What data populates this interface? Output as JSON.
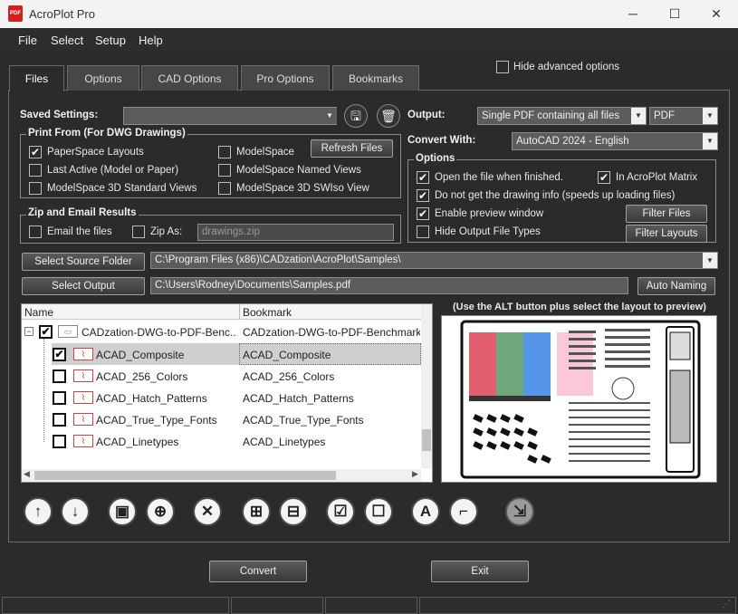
{
  "window": {
    "title": "AcroPlot Pro",
    "app_icon_label": "PDF"
  },
  "menu": [
    "File",
    "Select",
    "Setup",
    "Help"
  ],
  "tabs": [
    "Files",
    "Options",
    "CAD Options",
    "Pro Options",
    "Bookmarks"
  ],
  "hide_advanced": {
    "label": "Hide advanced options",
    "checked": false
  },
  "saved_settings": {
    "label": "Saved Settings:",
    "value": ""
  },
  "print_from": {
    "title": "Print From (For DWG Drawings)",
    "items": [
      {
        "label": "PaperSpace Layouts",
        "checked": true
      },
      {
        "label": "ModelSpace",
        "checked": false
      },
      {
        "label": "Last Active (Model or Paper)",
        "checked": false
      },
      {
        "label": "ModelSpace Named Views",
        "checked": false
      },
      {
        "label": "ModelSpace 3D Standard Views",
        "checked": false
      },
      {
        "label": "ModelSpace 3D SWIso View",
        "checked": false
      }
    ],
    "refresh_label": "Refresh Files"
  },
  "zip": {
    "title": "Zip and Email Results",
    "email": {
      "label": "Email the files",
      "checked": false
    },
    "zipas": {
      "label": "Zip As:",
      "checked": false
    },
    "filename": "drawings.zip"
  },
  "output": {
    "label": "Output:",
    "value": "Single PDF containing all files",
    "format": "PDF"
  },
  "convert_with": {
    "label": "Convert With:",
    "value": "AutoCAD 2024 - English"
  },
  "options": {
    "title": "Options",
    "items": [
      {
        "label": "Open the file when finished.",
        "checked": true
      },
      {
        "label": "In AcroPlot Matrix",
        "checked": true
      },
      {
        "label": "Do not get the drawing info (speeds up loading files)",
        "checked": true
      },
      {
        "label": "Enable preview window",
        "checked": true
      },
      {
        "label": "Hide Output File Types",
        "checked": false
      }
    ],
    "filter_files": "Filter Files",
    "filter_layouts": "Filter Layouts"
  },
  "source": {
    "button": "Select Source Folder",
    "path": "C:\\Program Files (x86)\\CADzation\\AcroPlot\\Samples\\"
  },
  "output_path": {
    "button": "Select Output",
    "path": "C:\\Users\\Rodney\\Documents\\Samples.pdf",
    "auto_naming": "Auto Naming"
  },
  "tree": {
    "headers": [
      "Name",
      "Bookmark"
    ],
    "root": {
      "name": "CADzation-DWG-to-PDF-Benc...",
      "bookmark": "CADzation-DWG-to-PDF-Benchmark",
      "expander": "−"
    },
    "children": [
      {
        "name": "ACAD_Composite",
        "bookmark": "ACAD_Composite",
        "checked": true,
        "selected": true
      },
      {
        "name": "ACAD_256_Colors",
        "bookmark": "ACAD_256_Colors",
        "checked": false,
        "selected": false
      },
      {
        "name": "ACAD_Hatch_Patterns",
        "bookmark": "ACAD_Hatch_Patterns",
        "checked": false,
        "selected": false
      },
      {
        "name": "ACAD_True_Type_Fonts",
        "bookmark": "ACAD_True_Type_Fonts",
        "checked": false,
        "selected": false
      },
      {
        "name": "ACAD_Linetypes",
        "bookmark": "ACAD_Linetypes",
        "checked": false,
        "selected": false
      }
    ]
  },
  "preview": {
    "caption": "(Use the ALT button plus select the layout to preview)"
  },
  "toolbar": [
    "move-up",
    "move-down",
    "add-folder",
    "add-file",
    "remove",
    "expand-all",
    "collapse-all",
    "check-all",
    "uncheck-all",
    "font-tool",
    "bookmark-tool",
    "add-to-tray"
  ],
  "actions": {
    "convert": "Convert",
    "exit": "Exit"
  },
  "colors": {
    "bg": "#2b2b2b",
    "panel_border": "#6a6a6a",
    "field": "#5c5c5c",
    "tree_select": "#cfcfcf"
  }
}
